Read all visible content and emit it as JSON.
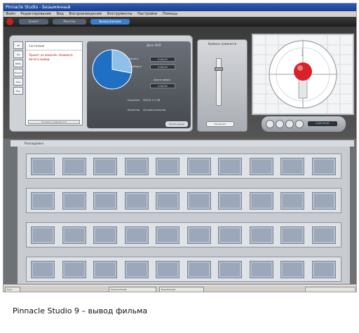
{
  "window": {
    "title": "Pinnacle Studio - Безымянный"
  },
  "menu": [
    "Файл",
    "Редактирование",
    "Вид",
    "Воспроизведение",
    "Инструменты",
    "Настройки",
    "Помощь"
  ],
  "modes": {
    "capture": "Захват",
    "edit": "Монтаж",
    "make_movie": "Вывод фильма"
  },
  "left_panel": {
    "side_tabs": [
      "3D",
      "AVI",
      "MPEG",
      "Stream",
      "Tape",
      "Disc"
    ],
    "status_title": "Состояние",
    "status_message": "Проект не изменён. Нажмите Начать вывод.",
    "status_button": "Показать подробности"
  },
  "disc_panel": {
    "title": "Диск DVD",
    "used_label": "Занято",
    "used_value": "0:00:00",
    "free_label": "Свободно",
    "free_value": "0:00:00",
    "length_label": "Длина видео",
    "length_value": "0:00:00",
    "media_label": "Носитель",
    "media_value": "DVD-R 4.7 GB",
    "quality_label": "Качество",
    "quality_value": "Лучшее качество",
    "start_button": "Начать вывод"
  },
  "mid_panel": {
    "title": "Уровень громкости",
    "button": "Настроить"
  },
  "player": {
    "time": "0:00:00.00"
  },
  "storyboard": {
    "title": "Раскадровка"
  },
  "taskbar": {
    "start": "Пуск",
    "app": "Pinnacle Studio",
    "doc": "Безымянный"
  },
  "caption": "Pinnacle Studio 9 – вывод фильма",
  "chart_data": {
    "type": "pie",
    "values": [
      28,
      72
    ],
    "colors": [
      "#8fc0ea",
      "#1f6fc4"
    ]
  }
}
